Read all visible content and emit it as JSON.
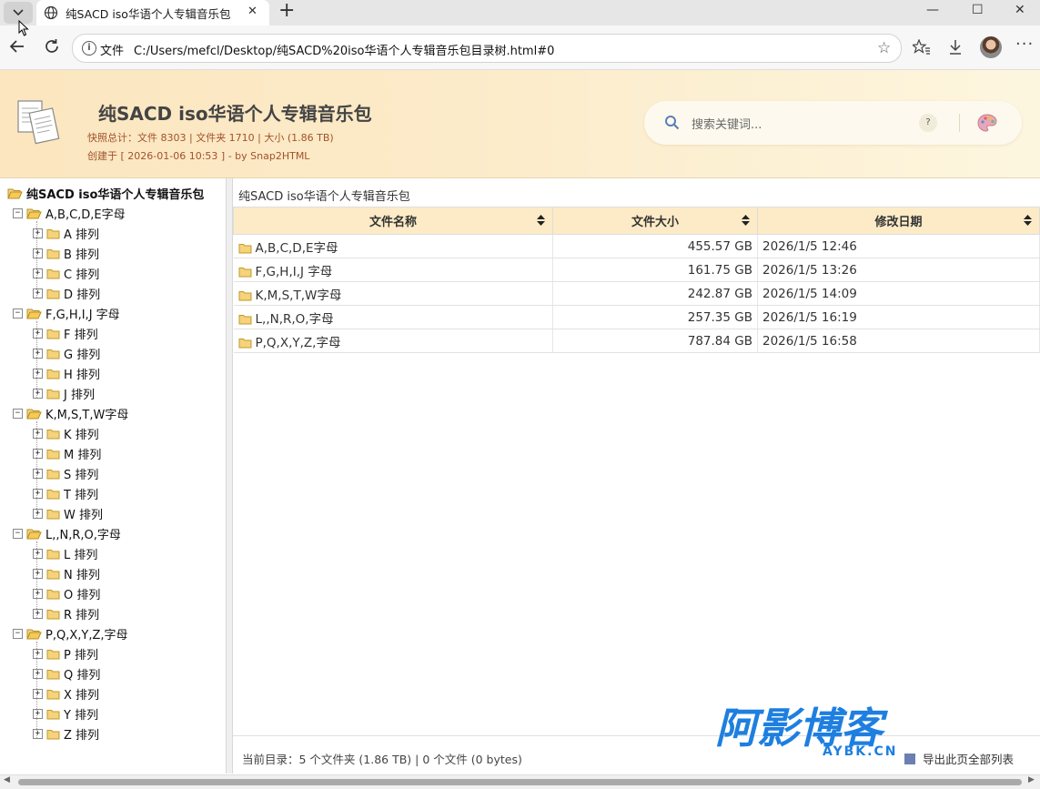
{
  "browser": {
    "tab_title": "纯SACD iso华语个人专辑音乐包",
    "tab_close": "✕",
    "new_tab": "+",
    "scheme_label": "文件",
    "url": "C:/Users/mefcl/Desktop/纯SACD%20iso华语个人专辑音乐包目录树.html#0",
    "window_min": "—",
    "window_max": "☐",
    "window_close": "✕"
  },
  "header": {
    "title": "纯SACD iso华语个人专辑音乐包",
    "stats": "快照总计：文件 8303 | 文件夹 1710 | 大小 (1.86 TB)",
    "created": "创建于 [ 2026-01-06 10:53 ] - by Snap2HTML",
    "search_placeholder": "搜索关键词...",
    "help_label": "?"
  },
  "tree": {
    "root": "纯SACD iso华语个人专辑音乐包",
    "groups": [
      {
        "label": "A,B,C,D,E字母",
        "children": [
          "A 排列",
          "B 排列",
          "C 排列",
          "D 排列"
        ]
      },
      {
        "label": "F,G,H,I,J 字母",
        "children": [
          "F 排列",
          "G 排列",
          "H 排列",
          "J 排列"
        ]
      },
      {
        "label": "K,M,S,T,W字母",
        "children": [
          "K 排列",
          "M 排列",
          "S 排列",
          "T 排列",
          "W 排列"
        ]
      },
      {
        "label": "L,,N,R,O,字母",
        "children": [
          "L 排列",
          "N 排列",
          "O 排列",
          "R 排列"
        ]
      },
      {
        "label": "P,Q,X,Y,Z,字母",
        "children": [
          "P 排列",
          "Q 排列",
          "X 排列",
          "Y 排列",
          "Z 排列"
        ]
      }
    ]
  },
  "content": {
    "breadcrumb": "纯SACD iso华语个人专辑音乐包",
    "columns": {
      "name": "文件名称",
      "size": "文件大小",
      "modified": "修改日期"
    },
    "rows": [
      {
        "name": "A,B,C,D,E字母",
        "size": "455.57 GB",
        "modified": "2026/1/5 12:46"
      },
      {
        "name": "F,G,H,I,J 字母",
        "size": "161.75 GB",
        "modified": "2026/1/5 13:26"
      },
      {
        "name": "K,M,S,T,W字母",
        "size": "242.87 GB",
        "modified": "2026/1/5 14:09"
      },
      {
        "name": "L,,N,R,O,字母",
        "size": "257.35 GB",
        "modified": "2026/1/5 16:19"
      },
      {
        "name": "P,Q,X,Y,Z,字母",
        "size": "787.84 GB",
        "modified": "2026/1/5 16:58"
      }
    ],
    "status": "当前目录：5 个文件夹 (1.86 TB) | 0 个文件 (0 bytes)",
    "export_label": "导出此页全部列表"
  },
  "watermark": {
    "main": "阿影博客",
    "sub": "AYBK.CN",
    "color": "#1e7fe0"
  },
  "colors": {
    "header_bg": "#fbe6bf",
    "table_header_bg": "#fcebc6",
    "folder": "#f2c660",
    "info_text": "#a0522d"
  }
}
